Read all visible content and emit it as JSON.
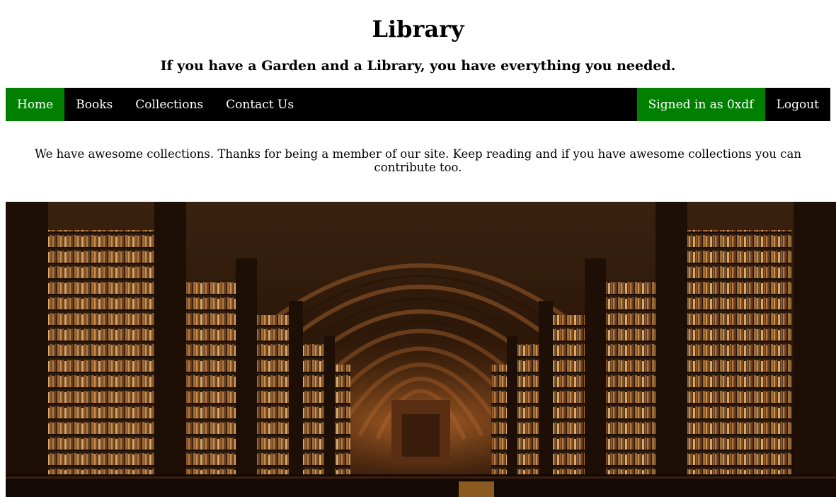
{
  "header": {
    "title": "Library",
    "subtitle": "If you have a Garden and a Library, you have everything you needed."
  },
  "nav": {
    "items": [
      {
        "label": "Home",
        "active": true
      },
      {
        "label": "Books",
        "active": false
      },
      {
        "label": "Collections",
        "active": false
      },
      {
        "label": "Contact Us",
        "active": false
      }
    ],
    "signed_in_label": "Signed in as 0xdf",
    "logout_label": "Logout"
  },
  "main": {
    "intro": "We have awesome collections. Thanks for being a member of our site. Keep reading and if you have awesome collections you can contribute too.",
    "hero_image": "library-hall-photo"
  },
  "colors": {
    "nav_background": "#000000",
    "active_background": "#008000",
    "nav_text": "#ffffff"
  }
}
